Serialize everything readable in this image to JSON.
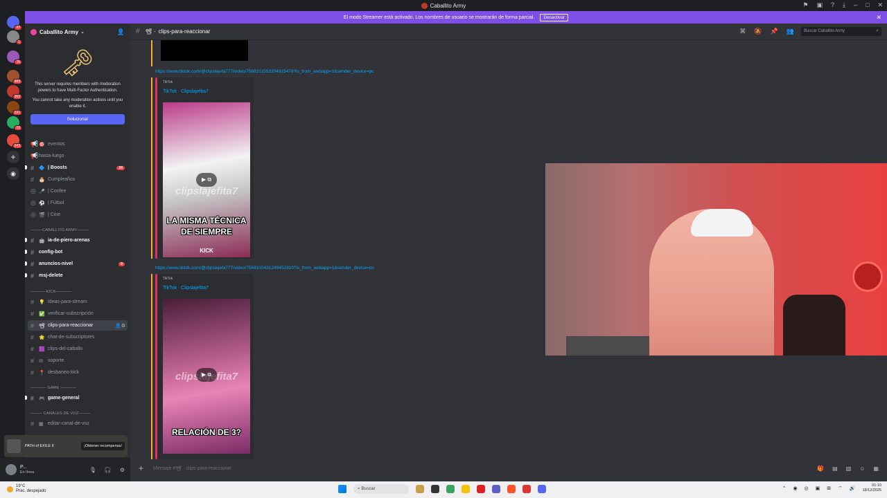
{
  "window": {
    "title": "Caballito Army"
  },
  "banner": {
    "text": "El modo Streamer está activado. Los nombres de usuario se mostrarán de forma parcial.",
    "button": "Desactivar"
  },
  "guilds": [
    {
      "badge": "47",
      "color": "#5865f2"
    },
    {
      "badge": "1",
      "color": "#888888"
    },
    {
      "badge": "75",
      "color": "#9b59b6"
    },
    {
      "badge": "383",
      "color": "#a0522d"
    },
    {
      "badge": "162",
      "color": "#c0392b"
    },
    {
      "badge": "121",
      "color": "#8b4513"
    },
    {
      "badge": "10",
      "color": "#27ae60"
    },
    {
      "badge": "243",
      "color": "#e74c3c"
    }
  ],
  "server": {
    "name": "Caballito Army"
  },
  "mfa": {
    "line1": "This server requires members with moderation powers to have Multi-Factor Authentication.",
    "line2": "You cannot take any moderation actions until you enable it.",
    "button": "Solucionar"
  },
  "channels": {
    "eventos": "eventos",
    "hasta_luego": "hasta-luego",
    "boosts": "| Boosts",
    "boosts_count": "24",
    "cumpleanos": "Cumpleaños",
    "confee": "| Confee",
    "futbol": "| Fútbol",
    "cine": "| Cine",
    "cat_caballito": "———CABALLITO ARMY———",
    "ia_de_piero": "ia-de-piero-arenas",
    "config_bot": "config-bot",
    "anuncios_nivel": "anuncios-nivel",
    "anuncios_count": "9",
    "msj_delete": "msj-delete",
    "cat_kick": "————KICK————",
    "ideas": "ideas-para-stream",
    "verificar": "verificar-subscripción",
    "clips_reaccionar": "clips-para-reaccionar",
    "chat_subs": "chat-de-subscriptores",
    "clips_caballo": "clips-del-caballo",
    "soporte": "soporte",
    "desbaneo": "desbaneo-kick",
    "cat_game": "———— GAME ————",
    "game_general": "game-general",
    "cat_voz": "——— CANALES DE VOZ———",
    "editar_voz": "editar-canal-de-voz"
  },
  "promo": {
    "title": "PATH of EXILE II",
    "button": "¡Obtener recompensa!"
  },
  "user": {
    "name": "P...",
    "status": "En línea"
  },
  "chat": {
    "channel": "clips-para-reaccionar",
    "search_placeholder": "Buscar Caballito Army",
    "composer_placeholder": "Mensaje #📽 · clips-para-reaccionar"
  },
  "messages": [
    {
      "link": "https://www.tiktok.com/@clipslajefa777/video/7568311553204915478?is_from_webapp=1&sender_device=pc",
      "provider": "TikTok",
      "title": "TikTok · Clipslajefita7",
      "watermark": "clipslajefita7",
      "caption": "LA MISMA TÉCNICA DE SIEMPRE",
      "brand": "KICK"
    },
    {
      "link": "https://www.tiktok.com/@clipslajefa777/video/7568310431249452310?is_from_webapp=1&sender_device=pc",
      "provider": "TikTok",
      "title": "TikTok · Clipslajefita7",
      "watermark": "clipslajefita7",
      "caption": "RELACIÓN DE 3?"
    }
  ],
  "taskbar": {
    "weather_temp": "19°C",
    "weather_desc": "Prac. despejado",
    "search": "Buscar",
    "time": "01:10",
    "date": "18/12/2025"
  }
}
